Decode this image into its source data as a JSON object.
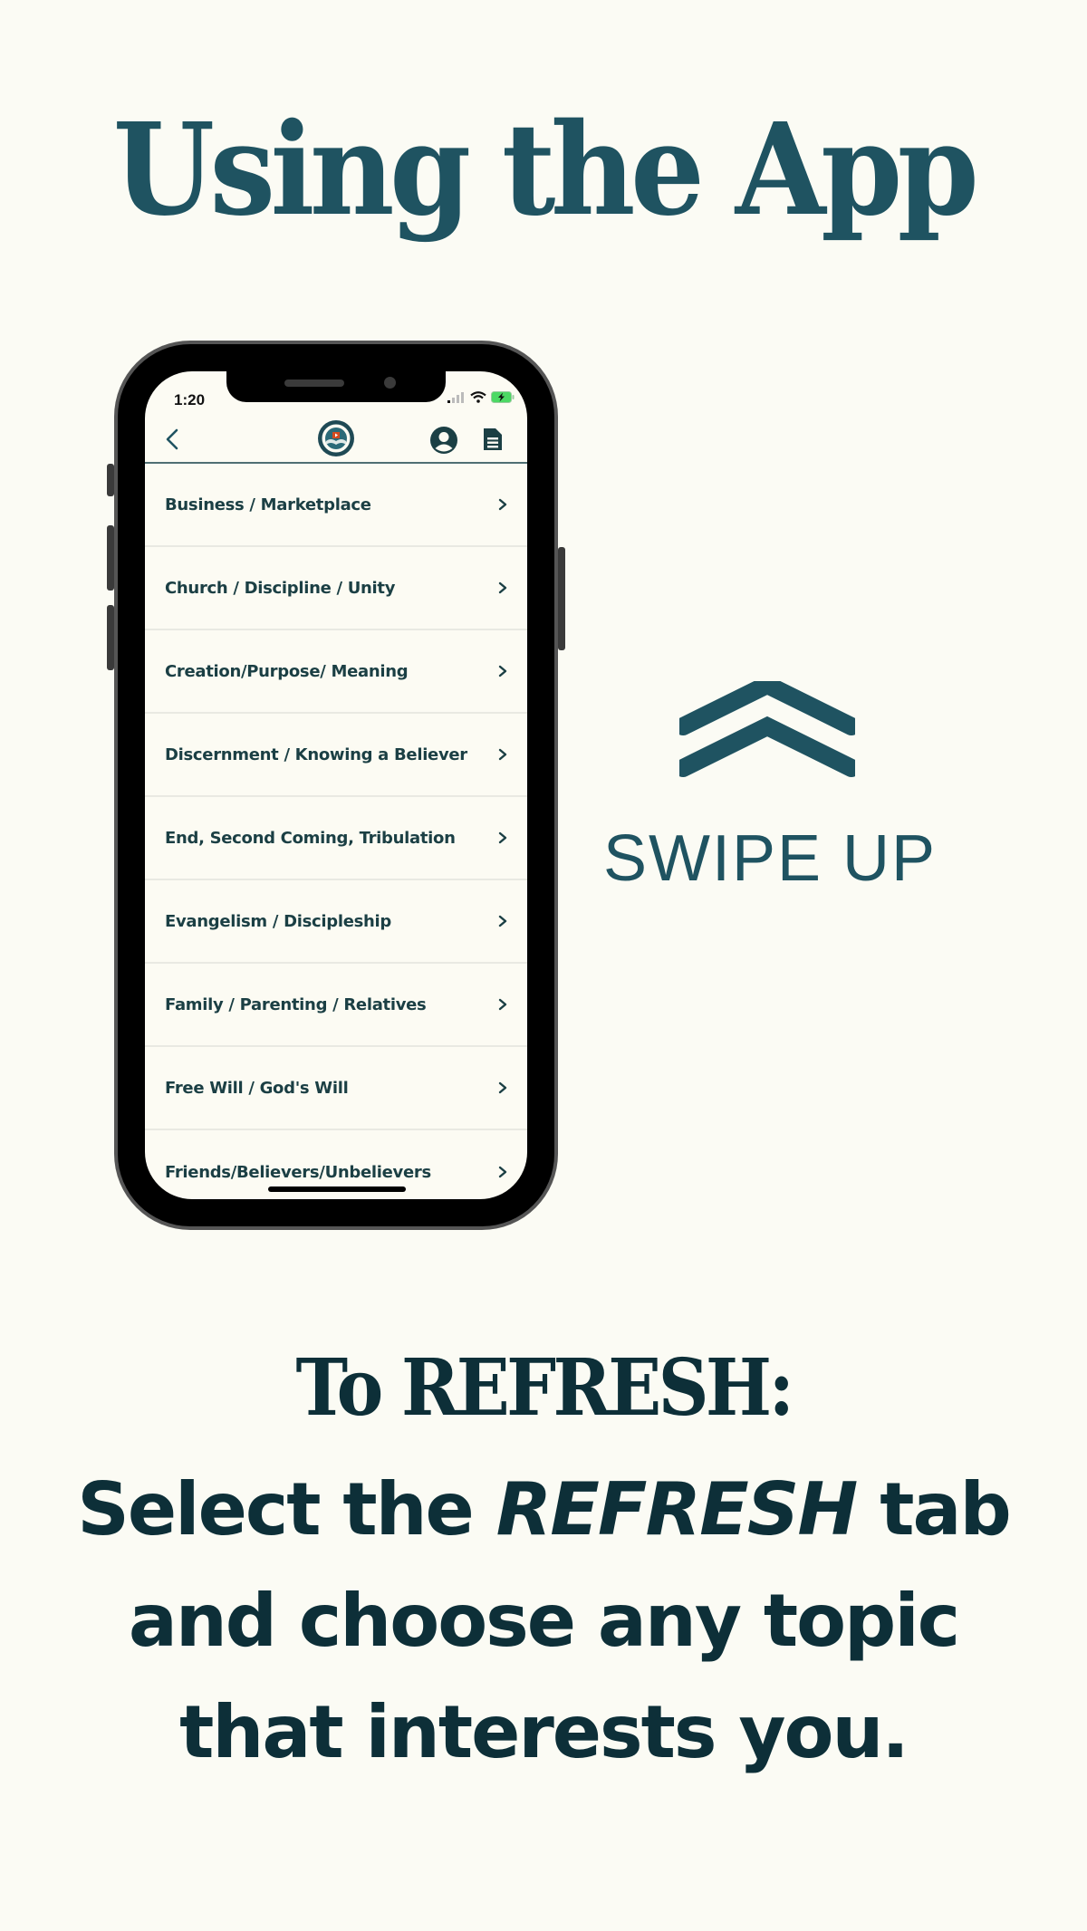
{
  "page": {
    "title": "Using the App",
    "swipe_label": "SWIPE UP",
    "refresh_heading": "To REFRESH:",
    "instructions": {
      "line1_before": "Select the ",
      "line1_em": "REFRESH",
      "line1_after": " tab",
      "line2": "and choose any topic",
      "line3": "that interests you."
    }
  },
  "phone": {
    "status_bar": {
      "time": "1:20",
      "icons": [
        "cellular-signal-icon",
        "wifi-icon",
        "battery-charging-icon"
      ]
    },
    "navbar": {
      "back_icon": "chevron-left-icon",
      "logo": "app-logo",
      "profile_icon": "user-circle-icon",
      "document_icon": "document-icon"
    },
    "topics": [
      {
        "label": "Business / Marketplace"
      },
      {
        "label": "Church / Discipline / Unity"
      },
      {
        "label": "Creation/Purpose/ Meaning"
      },
      {
        "label": "Discernment / Knowing a Believer"
      },
      {
        "label": "End, Second Coming, Tribulation"
      },
      {
        "label": "Evangelism / Discipleship"
      },
      {
        "label": "Family / Parenting / Relatives"
      },
      {
        "label": "Free Will / God's Will"
      },
      {
        "label": "Friends/Believers/Unbelievers"
      }
    ]
  },
  "colors": {
    "background": "#fbfbf4",
    "accent": "#1f5361",
    "dark_text": "#0d2f38",
    "list_text": "#1b3f44",
    "battery_green": "#4cd964"
  }
}
